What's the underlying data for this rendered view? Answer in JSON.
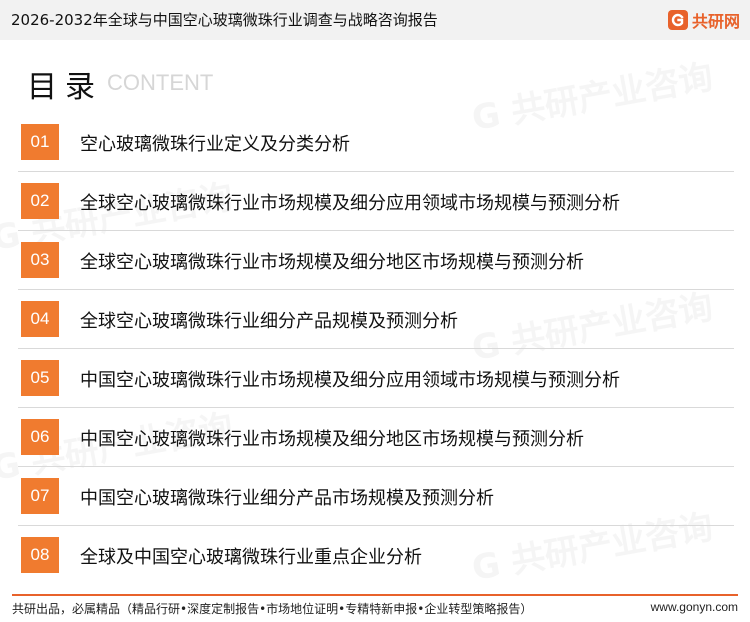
{
  "header": {
    "title": "2026-2032年全球与中国空心玻璃微珠行业调查与战略咨询报告",
    "logo_text": "共研网"
  },
  "heading": {
    "main": "目录",
    "sub": "CONTENT"
  },
  "toc": [
    {
      "num": "01",
      "label": "空心玻璃微珠行业定义及分类分析"
    },
    {
      "num": "02",
      "label": "全球空心玻璃微珠行业市场规模及细分应用领域市场规模与预测分析"
    },
    {
      "num": "03",
      "label": "全球空心玻璃微珠行业市场规模及细分地区市场规模与预测分析"
    },
    {
      "num": "04",
      "label": "全球空心玻璃微珠行业细分产品规模及预测分析"
    },
    {
      "num": "05",
      "label": "中国空心玻璃微珠行业市场规模及细分应用领域市场规模与预测分析"
    },
    {
      "num": "06",
      "label": "中国空心玻璃微珠行业市场规模及细分地区市场规模与预测分析"
    },
    {
      "num": "07",
      "label": "中国空心玻璃微珠行业细分产品市场规模及预测分析"
    },
    {
      "num": "08",
      "label": "全球及中国空心玻璃微珠行业重点企业分析"
    }
  ],
  "footer": {
    "left": "共研出品，必属精品（精品行研•深度定制报告•市场地位证明•专精特新申报•企业转型策略报告）",
    "right": "www.gonyn.com"
  },
  "colors": {
    "accent": "#f07b2f",
    "brand": "#e8622b",
    "divider": "#d9d9d9"
  }
}
